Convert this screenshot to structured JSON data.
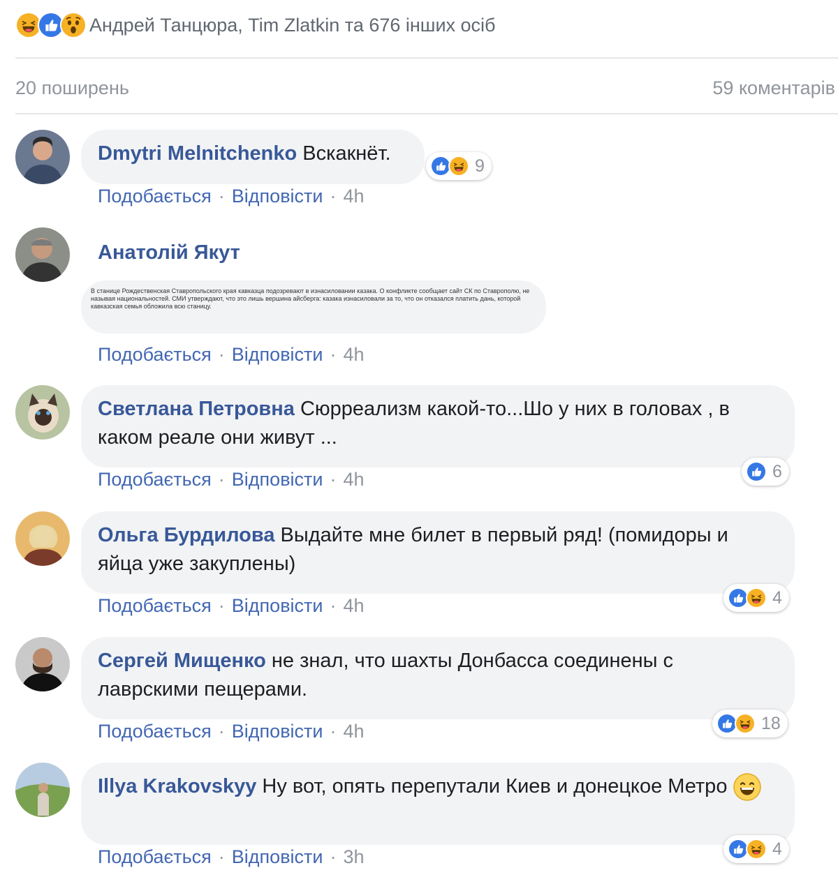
{
  "reactions_summary": {
    "icons": [
      "haha-icon",
      "like-icon",
      "wow-icon"
    ],
    "names": "Андрей Танцюра, Tim Zlatkin та 676 інших осіб"
  },
  "stats": {
    "shares": "20 поширень",
    "comments": "59 коментарів"
  },
  "actions": {
    "like": "Подобається",
    "reply": "Відповісти",
    "separator": "·"
  },
  "comments": [
    {
      "author": "Dmytri Melnitchenko",
      "text": "Вскакнёт.",
      "time": "4h",
      "reaction_icons": [
        "like-icon",
        "haha-icon"
      ],
      "reaction_count": "9"
    },
    {
      "author": "Анатолій Якут",
      "attachment_text": "В станице Рождественская Ставропольского края кавказца подозревают в изнасиловании казака. О конфликте сообщает сайт СК по Ставрополю, не называя национальностей. СМИ утверждают, что это лишь вершина айсберга: казака изнасиловали за то, что он отказался платить дань, которой кавказская семья обложила всю станицу.",
      "time": "4h"
    },
    {
      "author": "Светлана Петровна",
      "text": "Сюрреализм какой-то...Шо у них в головах , в каком реале они живут ...",
      "time": "4h",
      "reaction_icons": [
        "like-icon"
      ],
      "reaction_count": "6"
    },
    {
      "author": "Ольга Бурдилова",
      "text": "Выдайте мне билет в первый ряд! (помидоры и яйца уже закуплены)",
      "time": "4h",
      "reaction_icons": [
        "like-icon",
        "haha-icon"
      ],
      "reaction_count": "4"
    },
    {
      "author": "Сергей Мищенко",
      "text": "не знал, что шахты Донбасса соединены с лаврскими пещерами.",
      "time": "4h",
      "reaction_icons": [
        "like-icon",
        "haha-icon"
      ],
      "reaction_count": "18"
    },
    {
      "author": "Illya Krakovskyy",
      "text": "Ну вот, опять перепутали Киев и донецкое Метро",
      "inline_emoji": "smile-emoji",
      "time": "3h",
      "reaction_icons": [
        "like-icon",
        "haha-icon"
      ],
      "reaction_count": "4"
    }
  ],
  "colors": {
    "author": "#385898",
    "action_link": "#4267b2",
    "muted": "#90949c",
    "bubble": "#f2f3f5",
    "like_blue": "#3578e5",
    "haha_yellow": "#f7b125"
  }
}
